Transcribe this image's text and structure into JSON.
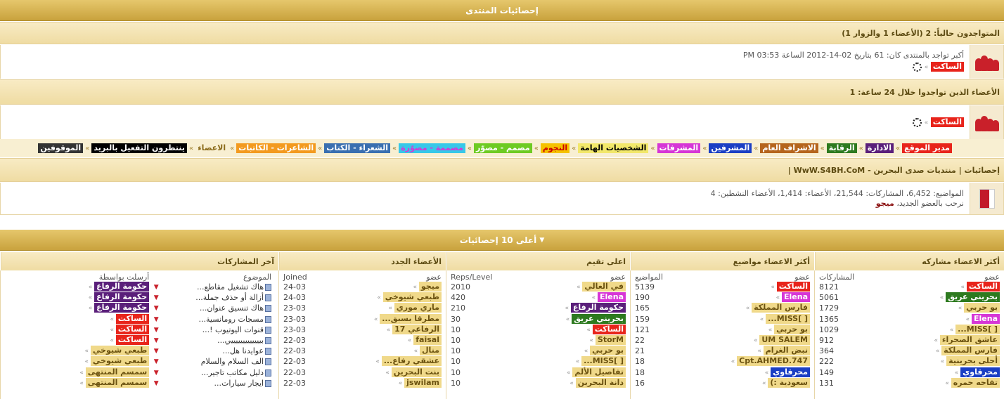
{
  "header": {
    "title": "إحصائيات المنتدى"
  },
  "online": {
    "label": "المتواجدون حالياً:",
    "count": "2",
    "detail": "(الأعضاء 1 والزوار 1)",
    "record": "أكبر تواجد بالمنتدى كان: 61 بتاريخ 02-14-2012 الساعة 03:53 PM",
    "user": "الساكت"
  },
  "last24": {
    "label": "الأعضاء الذين تواجدوا خلال 24 ساعة: 1",
    "user": "الساكت"
  },
  "legend": [
    {
      "label": "مدير الموقع",
      "color": "#e8241b",
      "text": "#fff"
    },
    {
      "label": "الادارة",
      "color": "#5a1f7a",
      "text": "#fff"
    },
    {
      "label": "الرقابة",
      "color": "#2d7a1f",
      "text": "#fff"
    },
    {
      "label": "الاشراف العام",
      "color": "#b5651d",
      "text": "#fff"
    },
    {
      "label": "المشرفين",
      "color": "#1b3fc4",
      "text": "#fff"
    },
    {
      "label": "المشرفات",
      "color": "#d636d6",
      "text": "#fff"
    },
    {
      "label": "الشخصيات الهامة",
      "color": "#f2e86a",
      "text": "#000"
    },
    {
      "label": "النجوم",
      "color": "#f5c200",
      "text": "#c00"
    },
    {
      "label": "مصمم - مصوّر",
      "color": "#6ecb23",
      "text": "#fff"
    },
    {
      "label": "مصممة - مصوّرة",
      "color": "#37c8e8",
      "text": "#d636d6"
    },
    {
      "label": "الشعراء - الكتاب",
      "color": "#3a6fb0",
      "text": "#fff"
    },
    {
      "label": "الشاعرات - الكاتبات",
      "color": "#f39a1f",
      "text": "#fff"
    },
    {
      "label": "الاعضاء",
      "color": "transparent",
      "text": "#8a6a1a"
    },
    {
      "label": "ينتظرون التفعيل بالبريد",
      "color": "#000",
      "text": "#fff"
    },
    {
      "label": "الموقوفين",
      "color": "#333",
      "text": "#fff"
    }
  ],
  "stats": {
    "title": "إحصائيات | منتديات صدى البحرين - WwW.S4BH.CoM |",
    "line": "المواضيع: 6,452، المشاركات: 21,544، الأعضاء: 1,414، الأعضاء النشطين: 4",
    "welcome": "نرحب بالعضو الجديد،",
    "newuser": "ميجو"
  },
  "top10": {
    "title": "أعلى 10 إحصائيات"
  },
  "columns": {
    "posters": {
      "title": "أكثر الاعضاء مشاركه",
      "h_member": "عضو",
      "h_count": "المشاركات",
      "rows": [
        {
          "name": "الساكت",
          "count": "8121",
          "bg": "#e8241b",
          "fg": "#fff"
        },
        {
          "name": "بحريني عريق",
          "count": "5061",
          "bg": "#2d7a1f",
          "fg": "#fff"
        },
        {
          "name": "بو حربي",
          "count": "1729",
          "bg": "#f0d98a",
          "fg": "#6b5210"
        },
        {
          "name": "Elena",
          "count": "1365",
          "bg": "#d636d6",
          "fg": "#fff"
        },
        {
          "name": "[ ]MISS...",
          "count": "1029",
          "bg": "#f0d98a",
          "fg": "#6b5210"
        },
        {
          "name": "عاشق الصحراء",
          "count": "912",
          "bg": "#f0d98a",
          "fg": "#6b5210"
        },
        {
          "name": "فارس المملكة",
          "count": "364",
          "bg": "#f0d98a",
          "fg": "#6b5210"
        },
        {
          "name": "أحلى بحرينية",
          "count": "222",
          "bg": "#f0d98a",
          "fg": "#6b5210"
        },
        {
          "name": "محرقاوي",
          "count": "149",
          "bg": "#1b3fc4",
          "fg": "#fff"
        },
        {
          "name": "تفاحه حمره",
          "count": "131",
          "bg": "#f0d98a",
          "fg": "#6b5210"
        }
      ]
    },
    "topics": {
      "title": "أكثر الاعضاء مواضيع",
      "h_member": "عضو",
      "h_count": "المواضيع",
      "rows": [
        {
          "name": "الساكت",
          "count": "5139",
          "bg": "#e8241b",
          "fg": "#fff"
        },
        {
          "name": "Elena",
          "count": "190",
          "bg": "#d636d6",
          "fg": "#fff"
        },
        {
          "name": "فارس المملكة",
          "count": "165",
          "bg": "#f0d98a",
          "fg": "#6b5210"
        },
        {
          "name": "[ ]MISS...",
          "count": "159",
          "bg": "#f0d98a",
          "fg": "#6b5210"
        },
        {
          "name": "بو حربي",
          "count": "121",
          "bg": "#f0d98a",
          "fg": "#6b5210"
        },
        {
          "name": "UM SALEM",
          "count": "22",
          "bg": "#f0d98a",
          "fg": "#6b5210"
        },
        {
          "name": "نبض الغرام",
          "count": "21",
          "bg": "#f0d98a",
          "fg": "#6b5210"
        },
        {
          "name": "Cpt.AHMED.747",
          "count": "18",
          "bg": "#f0d98a",
          "fg": "#6b5210"
        },
        {
          "name": "محرقاوي",
          "count": "18",
          "bg": "#1b3fc4",
          "fg": "#fff"
        },
        {
          "name": "سعودية :)",
          "count": "16",
          "bg": "#f0d98a",
          "fg": "#6b5210"
        }
      ]
    },
    "reps": {
      "title": "اعلى تقيم",
      "h_member": "عضو",
      "h_count": "Reps/Level",
      "rows": [
        {
          "name": "في العالي",
          "count": "2010",
          "bg": "#f0d98a",
          "fg": "#6b5210"
        },
        {
          "name": "Elena",
          "count": "420",
          "bg": "#d636d6",
          "fg": "#fff"
        },
        {
          "name": "حكومة الرفاع",
          "count": "210",
          "bg": "#5a1f7a",
          "fg": "#fff"
        },
        {
          "name": "بحريني عريق",
          "count": "30",
          "bg": "#2d7a1f",
          "fg": "#fff"
        },
        {
          "name": "الساكت",
          "count": "10",
          "bg": "#e8241b",
          "fg": "#fff"
        },
        {
          "name": "StorM",
          "count": "10",
          "bg": "#f0d98a",
          "fg": "#6b5210"
        },
        {
          "name": "بو حربي",
          "count": "10",
          "bg": "#f0d98a",
          "fg": "#6b5210"
        },
        {
          "name": "[ ]MISS...",
          "count": "10",
          "bg": "#f0d98a",
          "fg": "#6b5210"
        },
        {
          "name": "تفاصيل الألم",
          "count": "10",
          "bg": "#f0d98a",
          "fg": "#6b5210"
        },
        {
          "name": "دانة البحرين",
          "count": "10",
          "bg": "#f0d98a",
          "fg": "#6b5210"
        }
      ]
    },
    "newmem": {
      "title": "الأعضاء الجدد",
      "h_member": "عضو",
      "h_count": "Joined",
      "rows": [
        {
          "name": "ميجو",
          "count": "24-03",
          "bg": "#f0d98a",
          "fg": "#6b5210"
        },
        {
          "name": "طبعي شيوخي",
          "count": "24-03",
          "bg": "#f0d98a",
          "fg": "#6b5210"
        },
        {
          "name": "ماري موري",
          "count": "23-03",
          "bg": "#f0d98a",
          "fg": "#6b5210"
        },
        {
          "name": "مطرقا بسبق...",
          "count": "23-03",
          "bg": "#f0d98a",
          "fg": "#6b5210"
        },
        {
          "name": "الرفاعي 17",
          "count": "23-03",
          "bg": "#f0d98a",
          "fg": "#6b5210"
        },
        {
          "name": "faisal",
          "count": "22-03",
          "bg": "#f0d98a",
          "fg": "#6b5210"
        },
        {
          "name": "منال",
          "count": "22-03",
          "bg": "#f0d98a",
          "fg": "#6b5210"
        },
        {
          "name": "عشقي رفاع...",
          "count": "22-03",
          "bg": "#f0d98a",
          "fg": "#6b5210"
        },
        {
          "name": "بنت البحرين",
          "count": "22-03",
          "bg": "#f0d98a",
          "fg": "#6b5210"
        },
        {
          "name": "jswilam",
          "count": "22-03",
          "bg": "#f0d98a",
          "fg": "#6b5210"
        }
      ]
    },
    "lastposts": {
      "title": "آخر المشاركات",
      "h_topic": "الموضوع",
      "h_by": "أرسلت بواسطة",
      "rows": [
        {
          "topic": "هاك تشغيل مقاطع...",
          "by": "حكومة الرفاع",
          "bg": "#5a1f7a",
          "fg": "#fff"
        },
        {
          "topic": "أزالة أو حذف جملة...",
          "by": "حكومة الرفاع",
          "bg": "#5a1f7a",
          "fg": "#fff"
        },
        {
          "topic": "هاك تنسيق عنوان...",
          "by": "حكومة الرفاع",
          "bg": "#5a1f7a",
          "fg": "#fff"
        },
        {
          "topic": "مسجات رومانسية...",
          "by": "الساكت",
          "bg": "#e8241b",
          "fg": "#fff"
        },
        {
          "topic": "قنوات اليوتيوب !...",
          "by": "الساكت",
          "bg": "#e8241b",
          "fg": "#fff"
        },
        {
          "topic": "بيييييييييييييي...",
          "by": "الساكت",
          "bg": "#e8241b",
          "fg": "#fff"
        },
        {
          "topic": "عوايدنا هل...",
          "by": "طبعي شيوخي",
          "bg": "#f0d98a",
          "fg": "#6b5210"
        },
        {
          "topic": "الف السلام والسلام",
          "by": "طبعي شيوخي",
          "bg": "#f0d98a",
          "fg": "#6b5210"
        },
        {
          "topic": "دليل مكاتب تاجير...",
          "by": "سمسم المنتهى",
          "bg": "#f0d98a",
          "fg": "#6b5210"
        },
        {
          "topic": "ايجار سيارات...",
          "by": "سمسم المنتهى",
          "bg": "#f0d98a",
          "fg": "#6b5210"
        }
      ]
    }
  }
}
